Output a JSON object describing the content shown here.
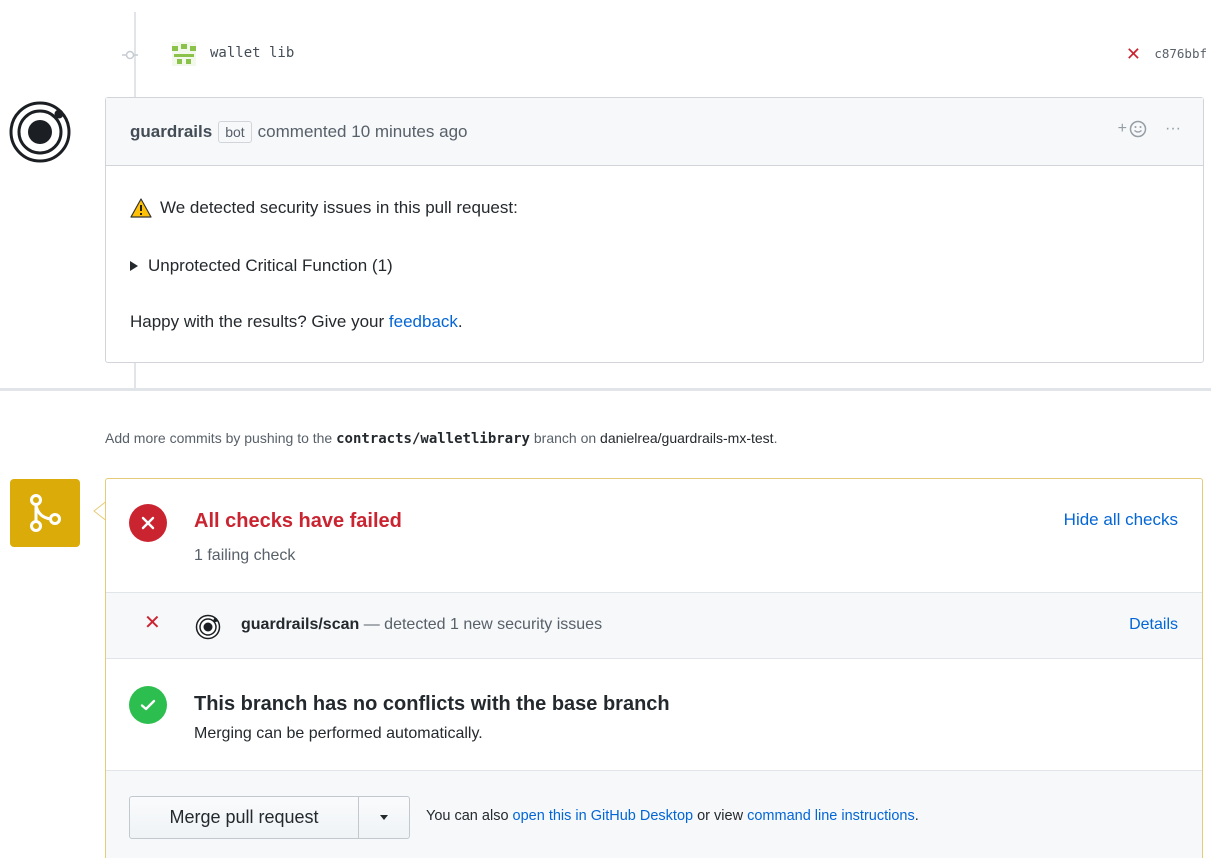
{
  "commit": {
    "message": "wallet lib",
    "status_icon": "x-icon",
    "sha": "c876bbf"
  },
  "comment": {
    "author": "guardrails",
    "badge": "bot",
    "action": "commented",
    "time": "10 minutes ago",
    "reaction_plus": "+",
    "more": "···",
    "line1": "We detected security issues in this pull request:",
    "line2": "Unprotected Critical Function (1)",
    "line3_prefix": "Happy with the results? Give your ",
    "line3_link": "feedback",
    "line3_suffix": "."
  },
  "push_note": {
    "prefix": "Add more commits by pushing to the ",
    "branch": "contracts/walletlibrary",
    "middle": " branch on ",
    "repo": "danielrea/guardrails-mx-test",
    "suffix": "."
  },
  "checks": {
    "title": "All checks have failed",
    "subtitle": "1 failing check",
    "toggle_label": "Hide all checks",
    "items": [
      {
        "name": "guardrails/scan",
        "description": " — detected 1 new security issues",
        "details_label": "Details"
      }
    ]
  },
  "conflicts": {
    "title": "This branch has no conflicts with the base branch",
    "subtitle": "Merging can be performed automatically."
  },
  "merge": {
    "button_label": "Merge pull request",
    "alt_prefix": "You can also ",
    "alt_link1": "open this in GitHub Desktop",
    "alt_middle": " or view ",
    "alt_link2": "command line instructions",
    "alt_suffix": "."
  },
  "colors": {
    "fail": "#cb2431",
    "success": "#2cbe4e",
    "merge_icon_bg": "#dbab09",
    "link": "#0366d6"
  }
}
